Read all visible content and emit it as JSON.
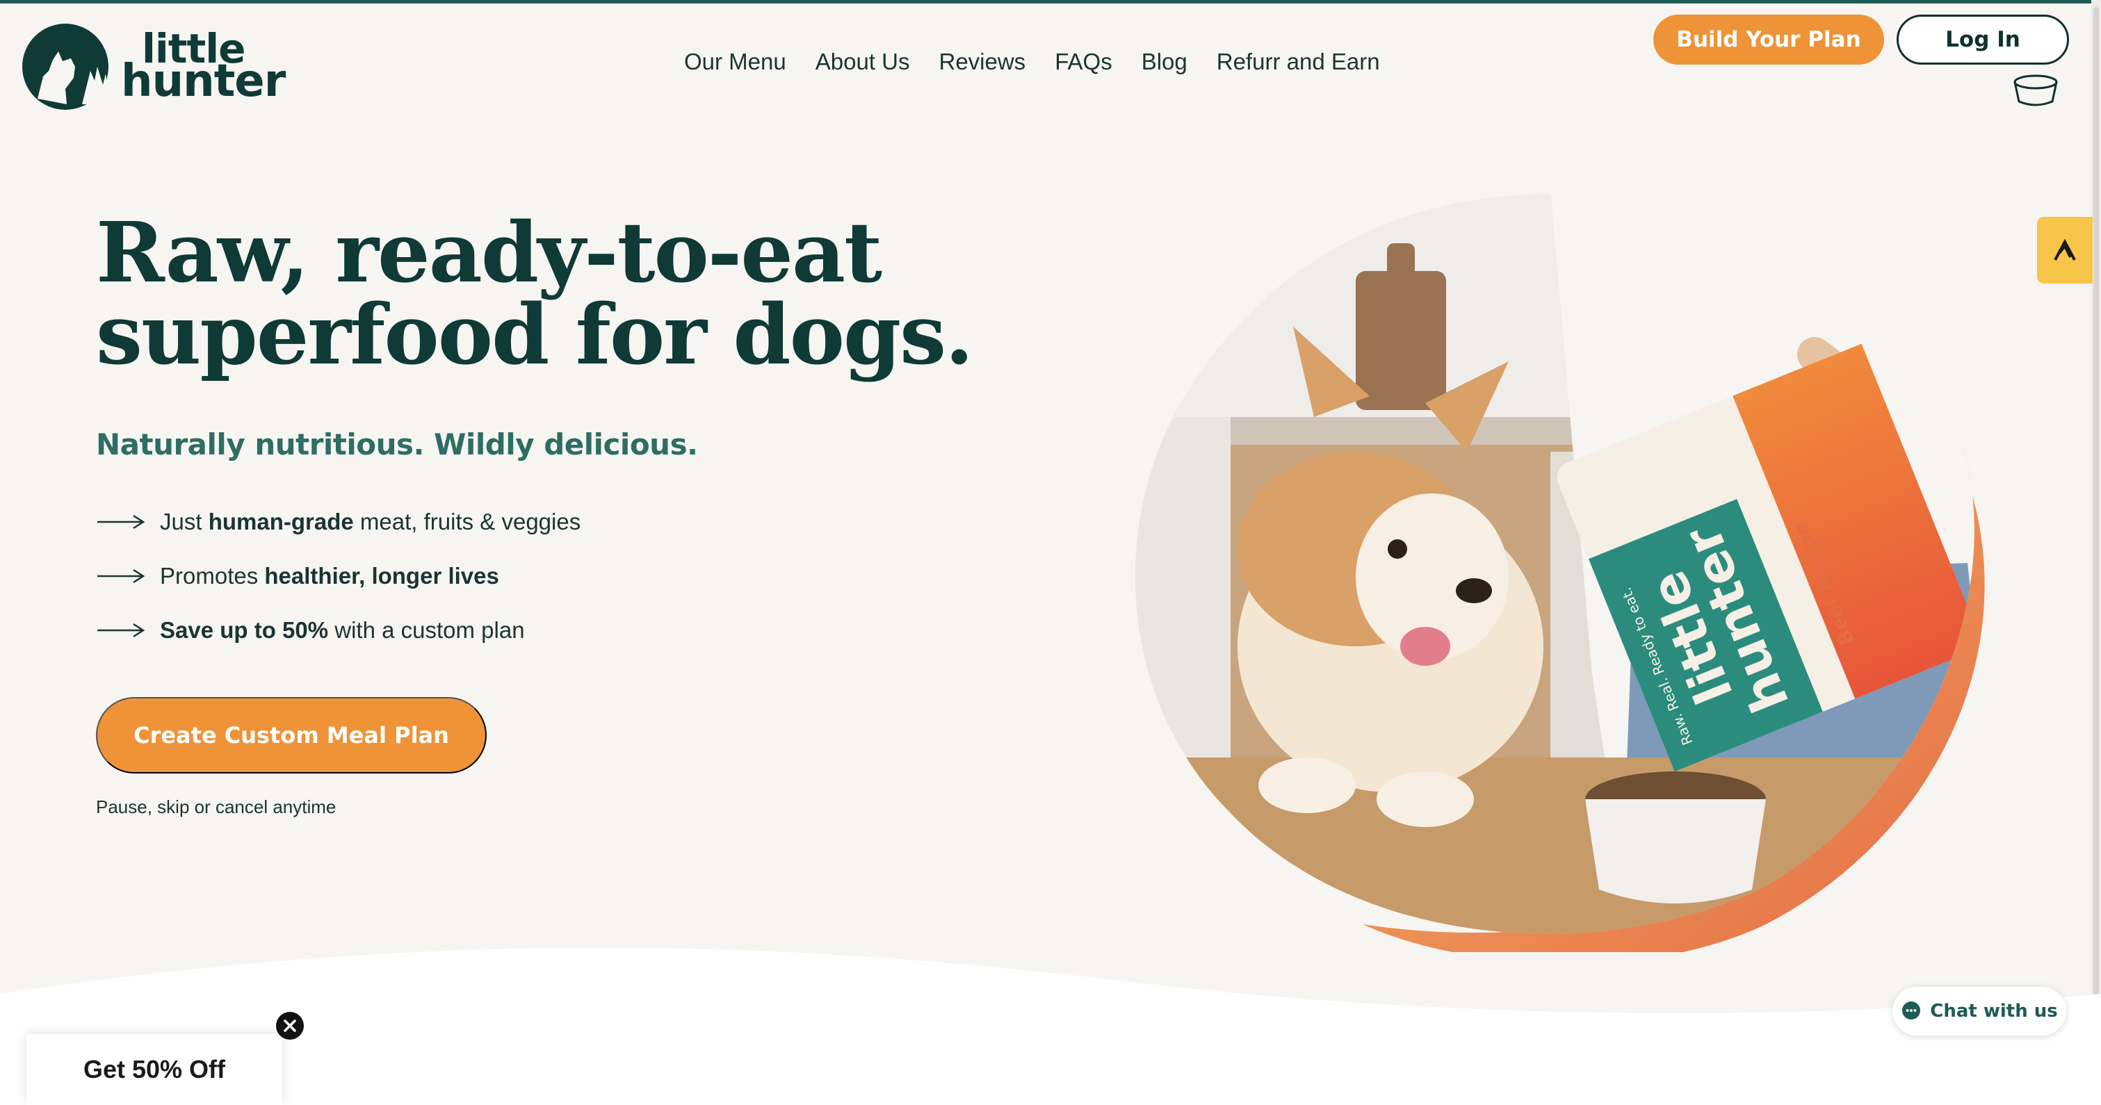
{
  "brand": {
    "line1": "little",
    "line2": "hunter"
  },
  "nav": {
    "items": [
      "Our Menu",
      "About Us",
      "Reviews",
      "FAQs",
      "Blog",
      "Refurr and Earn"
    ]
  },
  "header": {
    "build_label": "Build Your Plan",
    "login_label": "Log In"
  },
  "hero": {
    "title": "Raw, ready-to-eat superfood for dogs.",
    "subtitle": "Naturally nutritious. Wildly delicious.",
    "bullets": [
      {
        "pre": "Just ",
        "bold": "human-grade",
        "post": " meat, fruits & veggies"
      },
      {
        "pre": "Promotes ",
        "bold": "healthier, longer lives",
        "post": ""
      },
      {
        "pre": "",
        "bold": "Save up to 50%",
        "post": " with a custom plan"
      }
    ],
    "cta_label": "Create Custom Meal Plan",
    "cta_note": "Pause, skip or cancel anytime"
  },
  "package": {
    "brand_line1": "little",
    "brand_line2": "hunter",
    "tagline": "Raw. Real. Ready to eat.",
    "recipe": "Beef Recipe"
  },
  "chat": {
    "label": "Chat with us"
  },
  "promo": {
    "label": "Get 50% Off"
  },
  "colors": {
    "accent": "#ee9337",
    "brand_dark": "#0f3a36",
    "brand_teal": "#2e6d62",
    "background": "#f6f5f2",
    "side_tab": "#f6c54a"
  },
  "icons": {
    "bowl": "bowl-icon",
    "side_tab": "accessibility-widget-icon",
    "chat": "chat-bubble-icon",
    "close": "close-icon",
    "arrow": "arrow-right-icon"
  }
}
